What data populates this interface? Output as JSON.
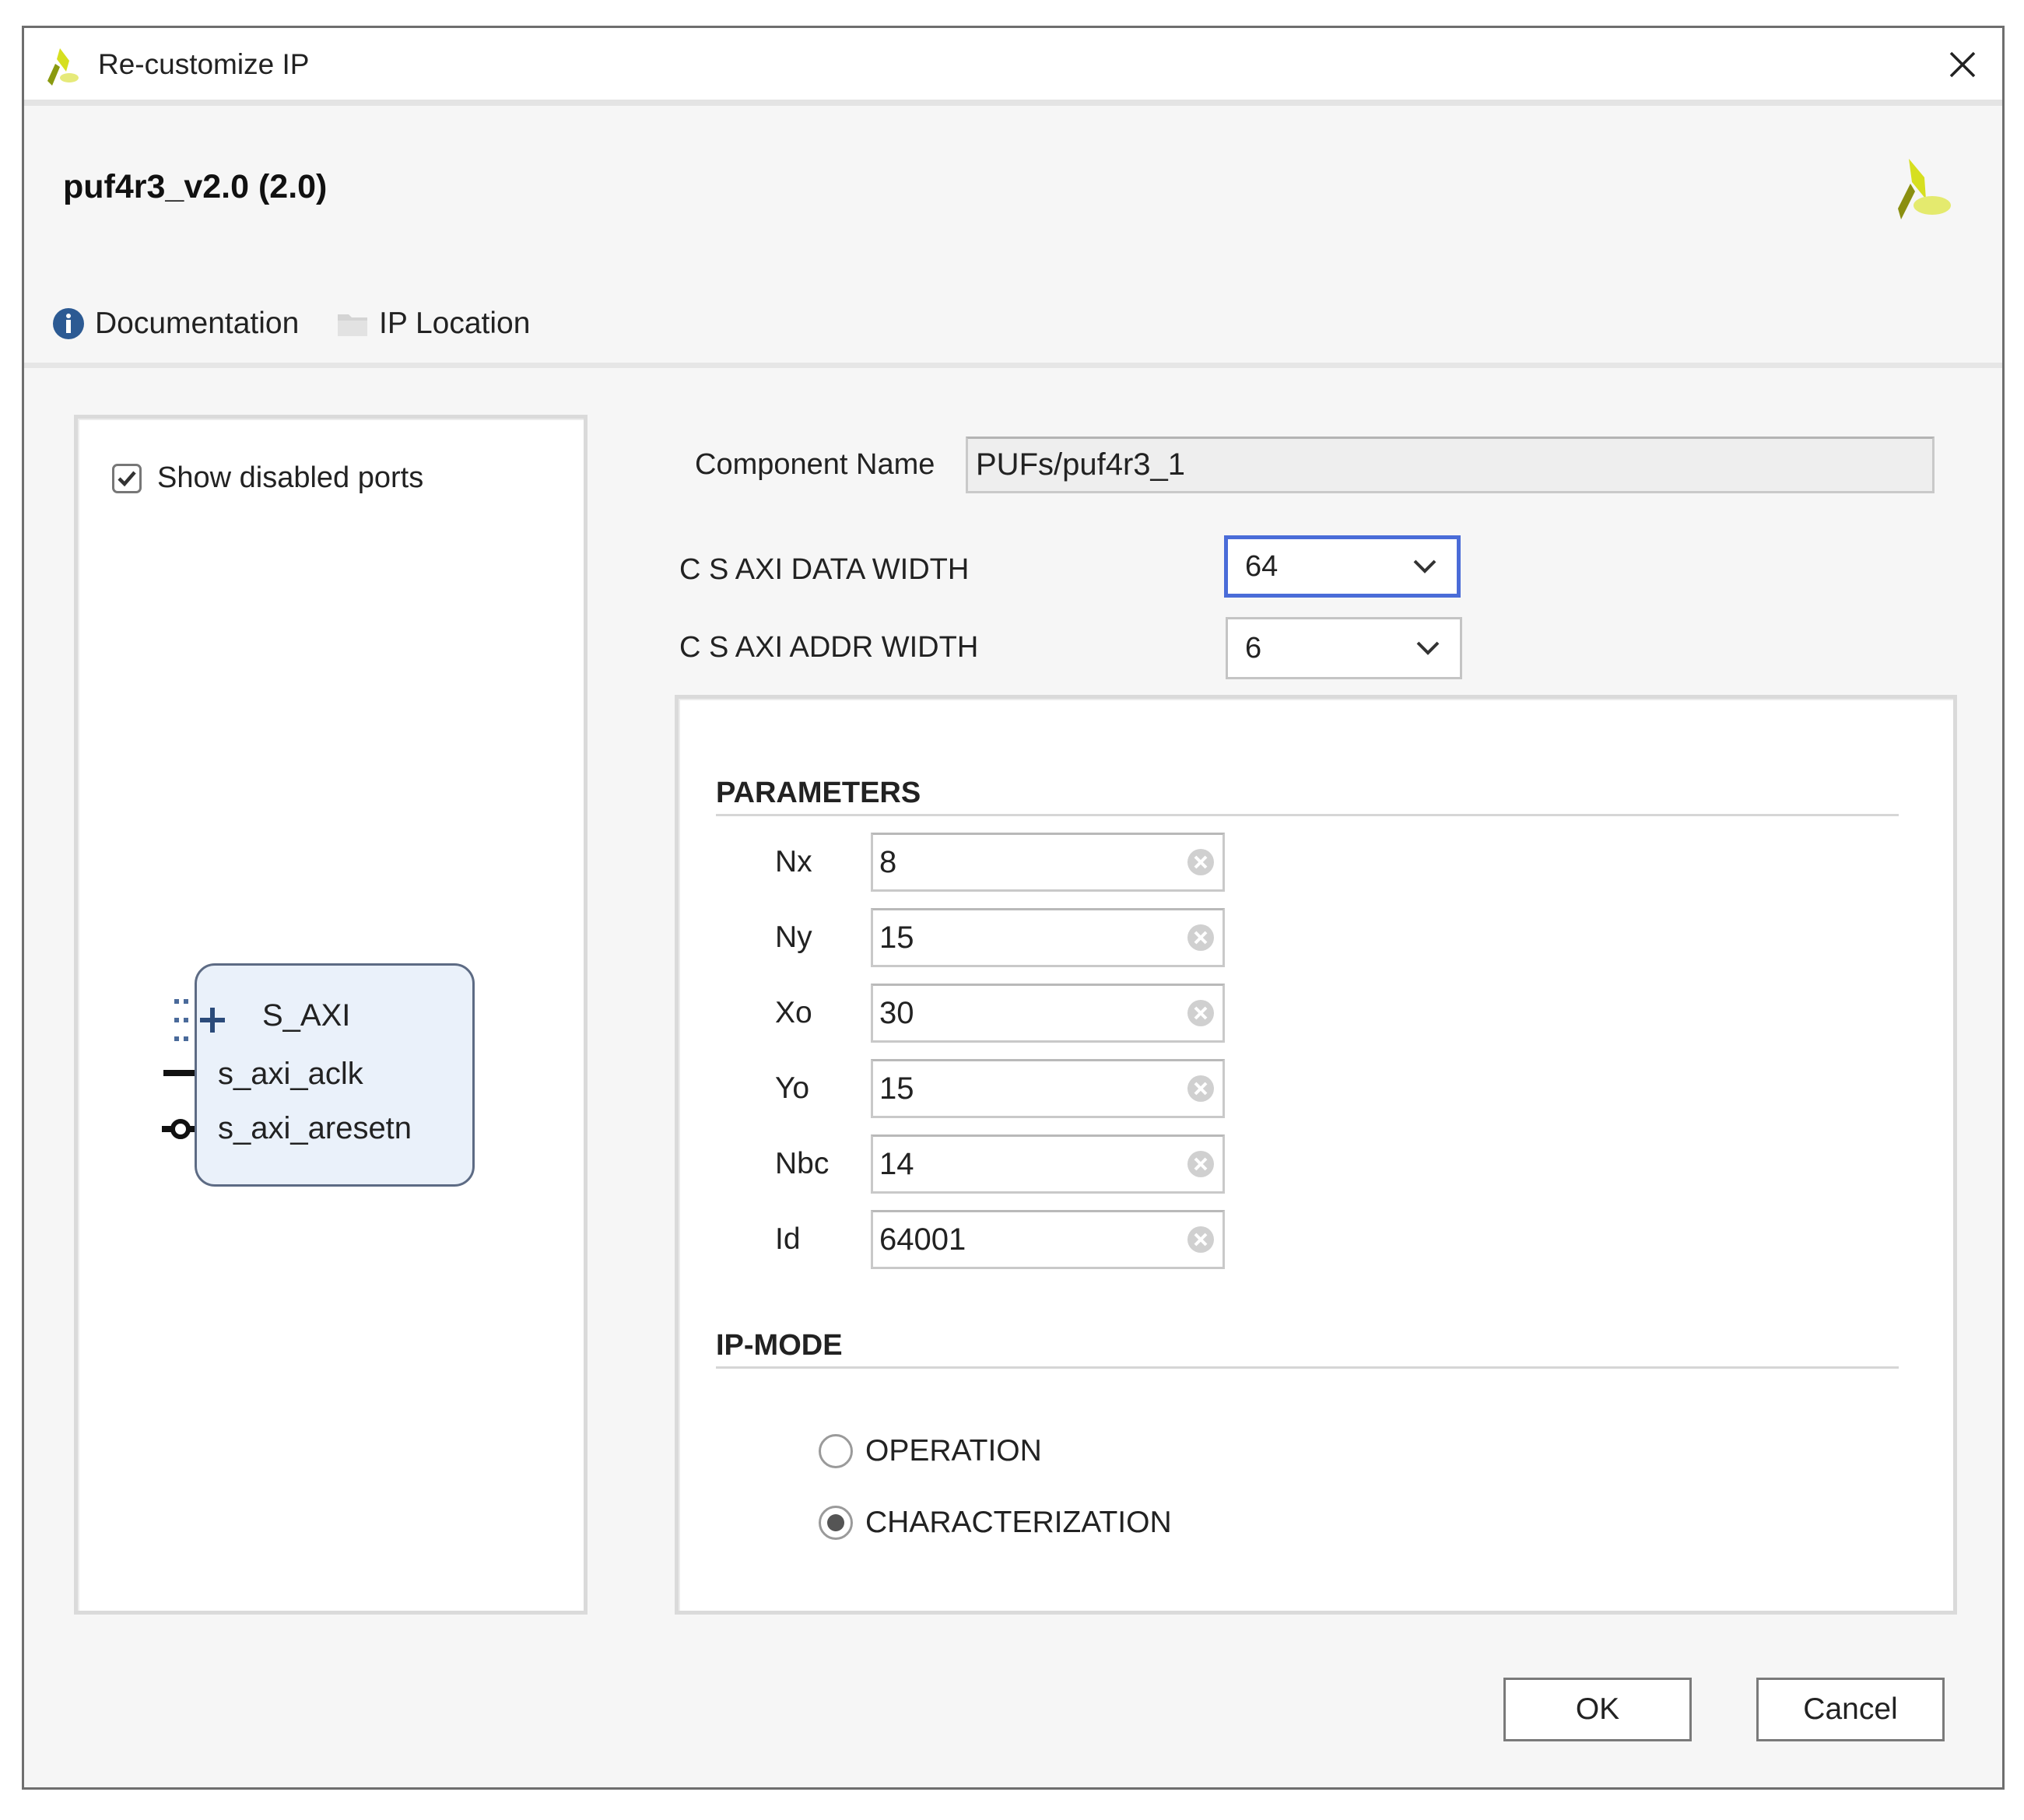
{
  "window": {
    "title": "Re-customize IP",
    "close_icon": "close-icon",
    "app_icon": "vivado-logo-icon"
  },
  "header": {
    "ip_name": "puf4r3_v2.0 (2.0)",
    "logo_icon": "vivado-logo-icon",
    "links": [
      {
        "label": "Documentation",
        "icon": "info-icon"
      },
      {
        "label": "IP Location",
        "icon": "folder-icon"
      }
    ]
  },
  "left_panel": {
    "show_disabled_ports": {
      "label": "Show disabled ports",
      "checked": true
    },
    "block": {
      "ports": [
        {
          "name": "S_AXI",
          "type": "bus-interface",
          "icon": "plus-icon"
        },
        {
          "name": "s_axi_aclk",
          "type": "clock"
        },
        {
          "name": "s_axi_aresetn",
          "type": "reset-active-low"
        }
      ]
    }
  },
  "config": {
    "component_name": {
      "label": "Component Name",
      "value": "PUFs/puf4r3_1"
    },
    "data_width": {
      "label": "C S AXI DATA WIDTH",
      "value": "64"
    },
    "addr_width": {
      "label": "C S AXI ADDR WIDTH",
      "value": "6"
    }
  },
  "parameters": {
    "title": "PARAMETERS",
    "fields": [
      {
        "label": "Nx",
        "value": "8"
      },
      {
        "label": "Ny",
        "value": "15"
      },
      {
        "label": "Xo",
        "value": "30"
      },
      {
        "label": "Yo",
        "value": "15"
      },
      {
        "label": "Nbc",
        "value": "14"
      },
      {
        "label": "Id",
        "value": "64001"
      }
    ]
  },
  "ip_mode": {
    "title": "IP-MODE",
    "options": [
      {
        "label": "OPERATION",
        "selected": false
      },
      {
        "label": "CHARACTERIZATION",
        "selected": true
      }
    ]
  },
  "buttons": {
    "ok": "OK",
    "cancel": "Cancel"
  },
  "colors": {
    "focus_border": "#4a6cd8",
    "info_icon": "#2c5a93",
    "logo_yellow": "#d9e21a",
    "logo_olive": "#8a8f10",
    "block_fill": "#eaf1fa",
    "block_border": "#5d6b84"
  }
}
